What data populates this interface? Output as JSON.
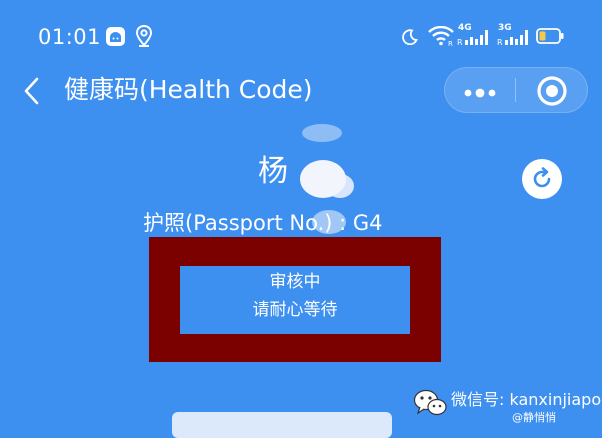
{
  "status_bar": {
    "time": "01:01",
    "network_1": "4G",
    "network_2": "3G",
    "battery_color": "#f7c948"
  },
  "header": {
    "title": "健康码(Health Code)"
  },
  "identity": {
    "name": "杨",
    "passport_line": "护照(Passport No.) : G4"
  },
  "review": {
    "title": "审核中",
    "subtitle": "请耐心等待"
  },
  "watermark": {
    "account": "微信号: kanxinjiapo",
    "author": "@静悄悄"
  },
  "colors": {
    "background": "#3d8ff0",
    "redaction": "#7b0000",
    "text": "#ffffff"
  },
  "icons": [
    "app-icon",
    "location-pin-icon",
    "moon-icon",
    "wifi-icon",
    "signal-icon",
    "battery-icon",
    "back-arrow-icon",
    "more-dots-icon",
    "close-target-icon",
    "refresh-icon",
    "wechat-logo-icon"
  ]
}
